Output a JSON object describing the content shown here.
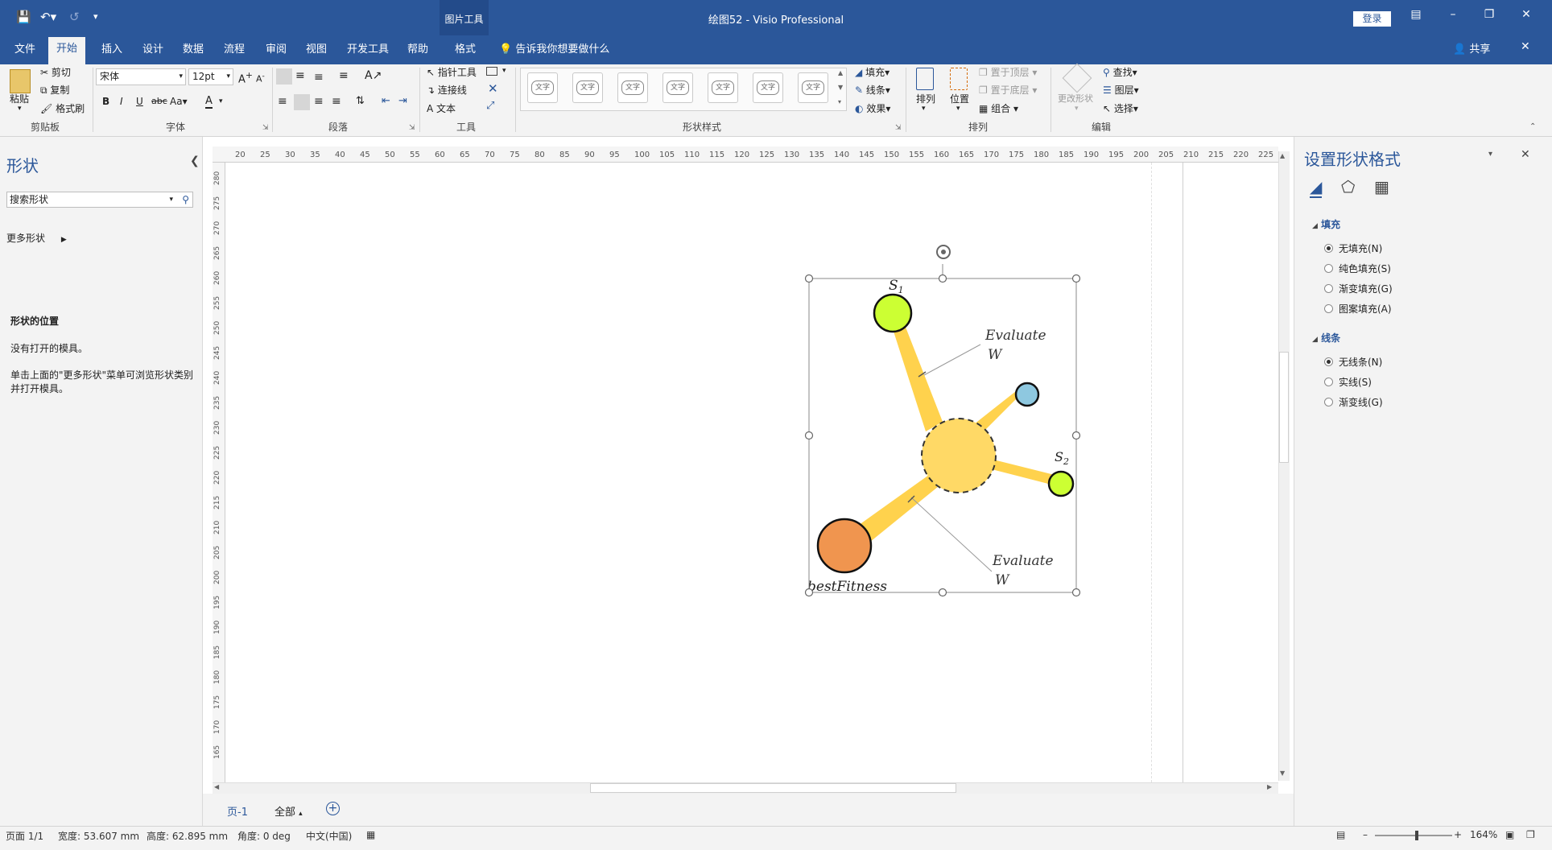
{
  "window": {
    "title": "绘图52  -  Visio Professional",
    "contextual_tab_group": "图片工具",
    "login": "登录"
  },
  "tabs": [
    "文件",
    "开始",
    "插入",
    "设计",
    "数据",
    "流程",
    "审阅",
    "视图",
    "开发工具",
    "帮助",
    "格式"
  ],
  "active_tab": "开始",
  "tell_me": "告诉我你想要做什么",
  "share": "共享",
  "ribbon": {
    "clipboard": {
      "paste": "粘贴",
      "cut": "剪切",
      "copy": "复制",
      "format_painter": "格式刷",
      "label": "剪贴板"
    },
    "font": {
      "name": "宋体",
      "size": "12pt",
      "label": "字体",
      "bold": "B",
      "italic": "I",
      "underline": "U",
      "strike": "abc",
      "case": "Aa",
      "color": "A"
    },
    "paragraph": {
      "label": "段落"
    },
    "tools": {
      "pointer": "指针工具",
      "connector": "连接线",
      "text": "文本",
      "label": "工具"
    },
    "shape_styles": {
      "label": "形状样式",
      "swatch": "文字",
      "fill": "填充",
      "line": "线条",
      "effects": "效果"
    },
    "arrange": {
      "arrange": "排列",
      "position": "位置",
      "bring_front": "置于顶层",
      "send_back": "置于底层",
      "group": "组合",
      "label": "排列"
    },
    "editing": {
      "change_shape": "更改形状",
      "find": "查找",
      "layers": "图层",
      "select": "选择",
      "label": "编辑"
    }
  },
  "shapes_pane": {
    "title": "形状",
    "search_placeholder": "搜索形状",
    "more_shapes": "更多形状",
    "position_title": "形状的位置",
    "no_stencils": "没有打开的模具。",
    "hint": "单击上面的\"更多形状\"菜单可浏览形状类别并打开模具。"
  },
  "ruler": {
    "top": [
      "20",
      "25",
      "30",
      "35",
      "40",
      "45",
      "50",
      "55",
      "60",
      "65",
      "70",
      "75",
      "80",
      "85",
      "90",
      "95",
      "100",
      "105",
      "110",
      "115",
      "120",
      "125",
      "130",
      "135",
      "140",
      "145",
      "150",
      "155",
      "160",
      "165",
      "170",
      "175",
      "180",
      "185",
      "190",
      "195",
      "200",
      "205",
      "210",
      "215",
      "220",
      "225"
    ],
    "left": [
      "280",
      "275",
      "270",
      "265",
      "260",
      "255",
      "250",
      "245",
      "240",
      "235",
      "230",
      "225",
      "220",
      "215",
      "210",
      "205",
      "200",
      "195",
      "190",
      "185",
      "180",
      "175",
      "170",
      "165"
    ]
  },
  "diagram": {
    "s1": "S",
    "s1_sub": "1",
    "s2": "S",
    "s2_sub": "2",
    "evaluate_top_1": "Evaluate",
    "evaluate_top_2": "W",
    "evaluate_bottom_1": "Evaluate",
    "evaluate_bottom_2": "W",
    "best": "bestFitness",
    "colors": {
      "green": "#ccff33",
      "blue": "#8ec8e0",
      "orange": "#f0954f",
      "center": "#ffd966",
      "arm": "#ffd24d"
    }
  },
  "page_tabs": {
    "page1": "页-1",
    "all": "全部"
  },
  "format_pane": {
    "title": "设置形状格式",
    "fill_section": "填充",
    "fill_options": [
      "无填充(N)",
      "纯色填充(S)",
      "渐变填充(G)",
      "图案填充(A)"
    ],
    "line_section": "线条",
    "line_options": [
      "无线条(N)",
      "实线(S)",
      "渐变线(G)"
    ]
  },
  "status": {
    "page": "页面 1/1",
    "width": "宽度: 53.607 mm",
    "height": "高度: 62.895 mm",
    "angle": "角度: 0 deg",
    "lang": "中文(中国)",
    "zoom": "164%"
  }
}
